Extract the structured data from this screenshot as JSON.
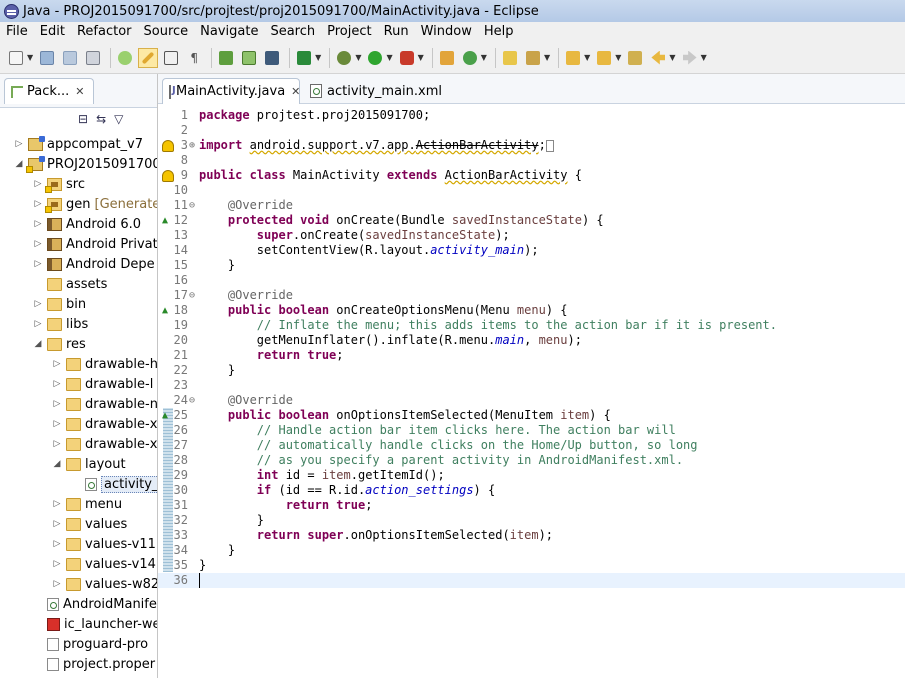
{
  "window": {
    "title": "Java - PROJ2015091700/src/projtest/proj2015091700/MainActivity.java - Eclipse"
  },
  "menu": [
    "File",
    "Edit",
    "Refactor",
    "Source",
    "Navigate",
    "Search",
    "Project",
    "Run",
    "Window",
    "Help"
  ],
  "explorer": {
    "tab_label": "Pack...",
    "tree": [
      {
        "label": "appcompat_v7",
        "icon": "project-icon",
        "depth": 0,
        "twisty": "▷"
      },
      {
        "label": "PROJ2015091700",
        "icon": "project-icon",
        "depth": 0,
        "twisty": "◢"
      },
      {
        "label": "src",
        "icon": "src-folder-icon",
        "depth": 1,
        "twisty": "▷"
      },
      {
        "label": "gen",
        "extra": "[Generated",
        "icon": "src-folder-icon",
        "depth": 1,
        "twisty": "▷"
      },
      {
        "label": "Android 6.0",
        "icon": "library-icon",
        "depth": 1,
        "twisty": "▷"
      },
      {
        "label": "Android Privat",
        "icon": "library-icon",
        "depth": 1,
        "twisty": "▷"
      },
      {
        "label": "Android Depe",
        "icon": "library-icon",
        "depth": 1,
        "twisty": "▷"
      },
      {
        "label": "assets",
        "icon": "folder-icon",
        "depth": 1,
        "twisty": ""
      },
      {
        "label": "bin",
        "icon": "folder-icon",
        "depth": 1,
        "twisty": "▷"
      },
      {
        "label": "libs",
        "icon": "folder-icon",
        "depth": 1,
        "twisty": "▷"
      },
      {
        "label": "res",
        "icon": "folder-icon",
        "depth": 1,
        "twisty": "◢"
      },
      {
        "label": "drawable-h",
        "icon": "folder-icon",
        "depth": 2,
        "twisty": "▷"
      },
      {
        "label": "drawable-l",
        "icon": "folder-icon",
        "depth": 2,
        "twisty": "▷"
      },
      {
        "label": "drawable-n",
        "icon": "folder-icon",
        "depth": 2,
        "twisty": "▷"
      },
      {
        "label": "drawable-x",
        "icon": "folder-icon",
        "depth": 2,
        "twisty": "▷"
      },
      {
        "label": "drawable-x",
        "icon": "folder-icon",
        "depth": 2,
        "twisty": "▷"
      },
      {
        "label": "layout",
        "icon": "folder-icon",
        "depth": 2,
        "twisty": "◢"
      },
      {
        "label": "activity_",
        "icon": "xml-file-icon",
        "depth": 3,
        "twisty": "",
        "selected": true
      },
      {
        "label": "menu",
        "icon": "folder-icon",
        "depth": 2,
        "twisty": "▷"
      },
      {
        "label": "values",
        "icon": "folder-icon",
        "depth": 2,
        "twisty": "▷"
      },
      {
        "label": "values-v11",
        "icon": "folder-icon",
        "depth": 2,
        "twisty": "▷"
      },
      {
        "label": "values-v14",
        "icon": "folder-icon",
        "depth": 2,
        "twisty": "▷"
      },
      {
        "label": "values-w82",
        "icon": "folder-icon",
        "depth": 2,
        "twisty": "▷"
      },
      {
        "label": "AndroidManife",
        "icon": "xml-file-icon",
        "depth": 1,
        "twisty": ""
      },
      {
        "label": "ic_launcher-we",
        "icon": "image-file-icon",
        "depth": 1,
        "twisty": ""
      },
      {
        "label": "proguard-pro",
        "icon": "file-icon",
        "depth": 1,
        "twisty": ""
      },
      {
        "label": "project.proper",
        "icon": "file-icon",
        "depth": 1,
        "twisty": ""
      }
    ]
  },
  "editor": {
    "tabs": [
      {
        "label": "MainActivity.java",
        "active": true,
        "type": "java"
      },
      {
        "label": "activity_main.xml",
        "active": false,
        "type": "xml"
      }
    ],
    "lines": [
      {
        "n": 1,
        "html": "<span class=\"kw\">package</span> projtest.proj2015091700;"
      },
      {
        "n": 2,
        "html": ""
      },
      {
        "n": 3,
        "html": "<span class=\"kw\">import</span> <span class=\"squiggle\">android.support.v7.app.<span class=\"dep\">ActionBarActivity</span></span>;<span style=\"border:1px solid #888;display:inline-block;width:8px;height:12px;vertical-align:middle;\"></span>",
        "fold": "⊕",
        "mark": "warn"
      },
      {
        "n": 8,
        "html": ""
      },
      {
        "n": 9,
        "html": "<span class=\"kw\">public class</span> MainActivity <span class=\"kw\">extends</span> <span class=\"squiggle dep\">ActionBarActivity</span> {",
        "mark": "warn"
      },
      {
        "n": 10,
        "html": ""
      },
      {
        "n": 11,
        "html": "    <span class=\"ann\">@Override</span>",
        "fold": "⊖"
      },
      {
        "n": 12,
        "html": "    <span class=\"kw\">protected void</span> onCreate(Bundle <span class=\"pm\">savedInstanceState</span>) {",
        "mark": "ovr"
      },
      {
        "n": 13,
        "html": "        <span class=\"kw\">super</span>.onCreate(<span class=\"pm\">savedInstanceState</span>);"
      },
      {
        "n": 14,
        "html": "        setContentView(R.layout.<span class=\"it\">activity_main</span>);"
      },
      {
        "n": 15,
        "html": "    }"
      },
      {
        "n": 16,
        "html": ""
      },
      {
        "n": 17,
        "html": "    <span class=\"ann\">@Override</span>",
        "fold": "⊖"
      },
      {
        "n": 18,
        "html": "    <span class=\"kw\">public boolean</span> onCreateOptionsMenu(Menu <span class=\"pm\">menu</span>) {",
        "mark": "ovr"
      },
      {
        "n": 19,
        "html": "        <span class=\"cm\">// Inflate the menu; this adds items to the action bar if it is present.</span>"
      },
      {
        "n": 20,
        "html": "        getMenuInflater().inflate(R.menu.<span class=\"it\">main</span>, <span class=\"pm\">menu</span>);"
      },
      {
        "n": 21,
        "html": "        <span class=\"kw\">return true</span>;"
      },
      {
        "n": 22,
        "html": "    }"
      },
      {
        "n": 23,
        "html": ""
      },
      {
        "n": 24,
        "html": "    <span class=\"ann\">@Override</span>",
        "fold": "⊖"
      },
      {
        "n": 25,
        "html": "    <span class=\"kw\">public boolean</span> onOptionsItemSelected(MenuItem <span class=\"pm\">item</span>) {",
        "mark": "ovr"
      },
      {
        "n": 26,
        "html": "        <span class=\"cm\">// Handle action bar item clicks here. The action bar will</span>"
      },
      {
        "n": 27,
        "html": "        <span class=\"cm\">// automatically handle clicks on the Home/Up button, so long</span>"
      },
      {
        "n": 28,
        "html": "        <span class=\"cm\">// as you specify a parent activity in AndroidManifest.xml.</span>"
      },
      {
        "n": 29,
        "html": "        <span class=\"kw\">int</span> id = <span class=\"pm\">item</span>.getItemId();"
      },
      {
        "n": 30,
        "html": "        <span class=\"kw\">if</span> (id == R.id.<span class=\"it\">action_settings</span>) {"
      },
      {
        "n": 31,
        "html": "            <span class=\"kw\">return true</span>;"
      },
      {
        "n": 32,
        "html": "        }"
      },
      {
        "n": 33,
        "html": "        <span class=\"kw\">return super</span>.onOptionsItemSelected(<span class=\"pm\">item</span>);"
      },
      {
        "n": 34,
        "html": "    }"
      },
      {
        "n": 35,
        "html": "}"
      },
      {
        "n": 36,
        "html": "",
        "current": true
      }
    ]
  }
}
